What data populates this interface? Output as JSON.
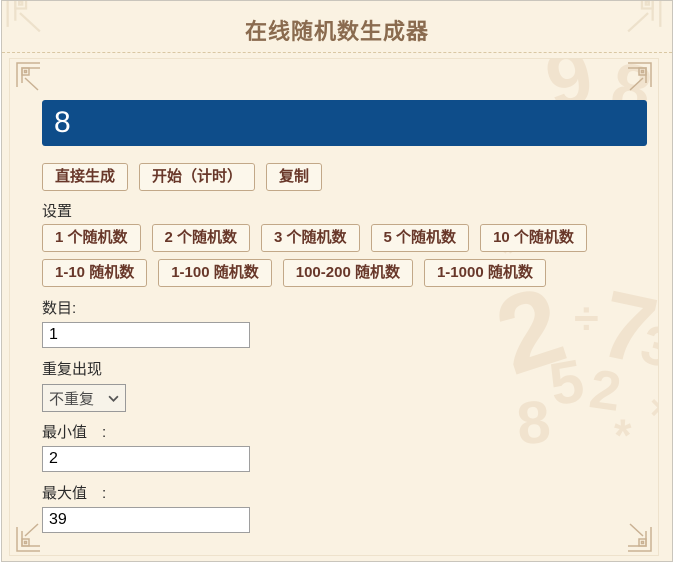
{
  "page": {
    "title": "在线随机数生成器"
  },
  "result": {
    "value": "8"
  },
  "actions": {
    "generate": "直接生成",
    "start_timer": "开始（计时）",
    "copy": "复制"
  },
  "settings": {
    "section_label": "设置",
    "count_presets": [
      "1 个随机数",
      "2 个随机数",
      "3 个随机数",
      "5 个随机数",
      "10 个随机数"
    ],
    "range_presets": [
      "1-10 随机数",
      "1-100 随机数",
      "100-200 随机数",
      "1-1000 随机数"
    ],
    "count": {
      "label": "数目:",
      "value": "1"
    },
    "repeat": {
      "label": "重复出现",
      "selected_option": "不重复"
    },
    "min": {
      "label": "最小值　:",
      "value": "2"
    },
    "max": {
      "label": "最大值　:",
      "value": "39"
    }
  },
  "colors": {
    "accent_blue": "#0e4d8a",
    "button_text": "#683729",
    "button_border": "#c2a888",
    "title_brown": "#8a6b4f",
    "background_cream": "#faf2e2"
  },
  "watermark": {
    "chars": [
      "2",
      "7",
      "5",
      "2",
      "8",
      "÷",
      "3",
      "*",
      "×",
      "9",
      "*",
      "8"
    ]
  }
}
